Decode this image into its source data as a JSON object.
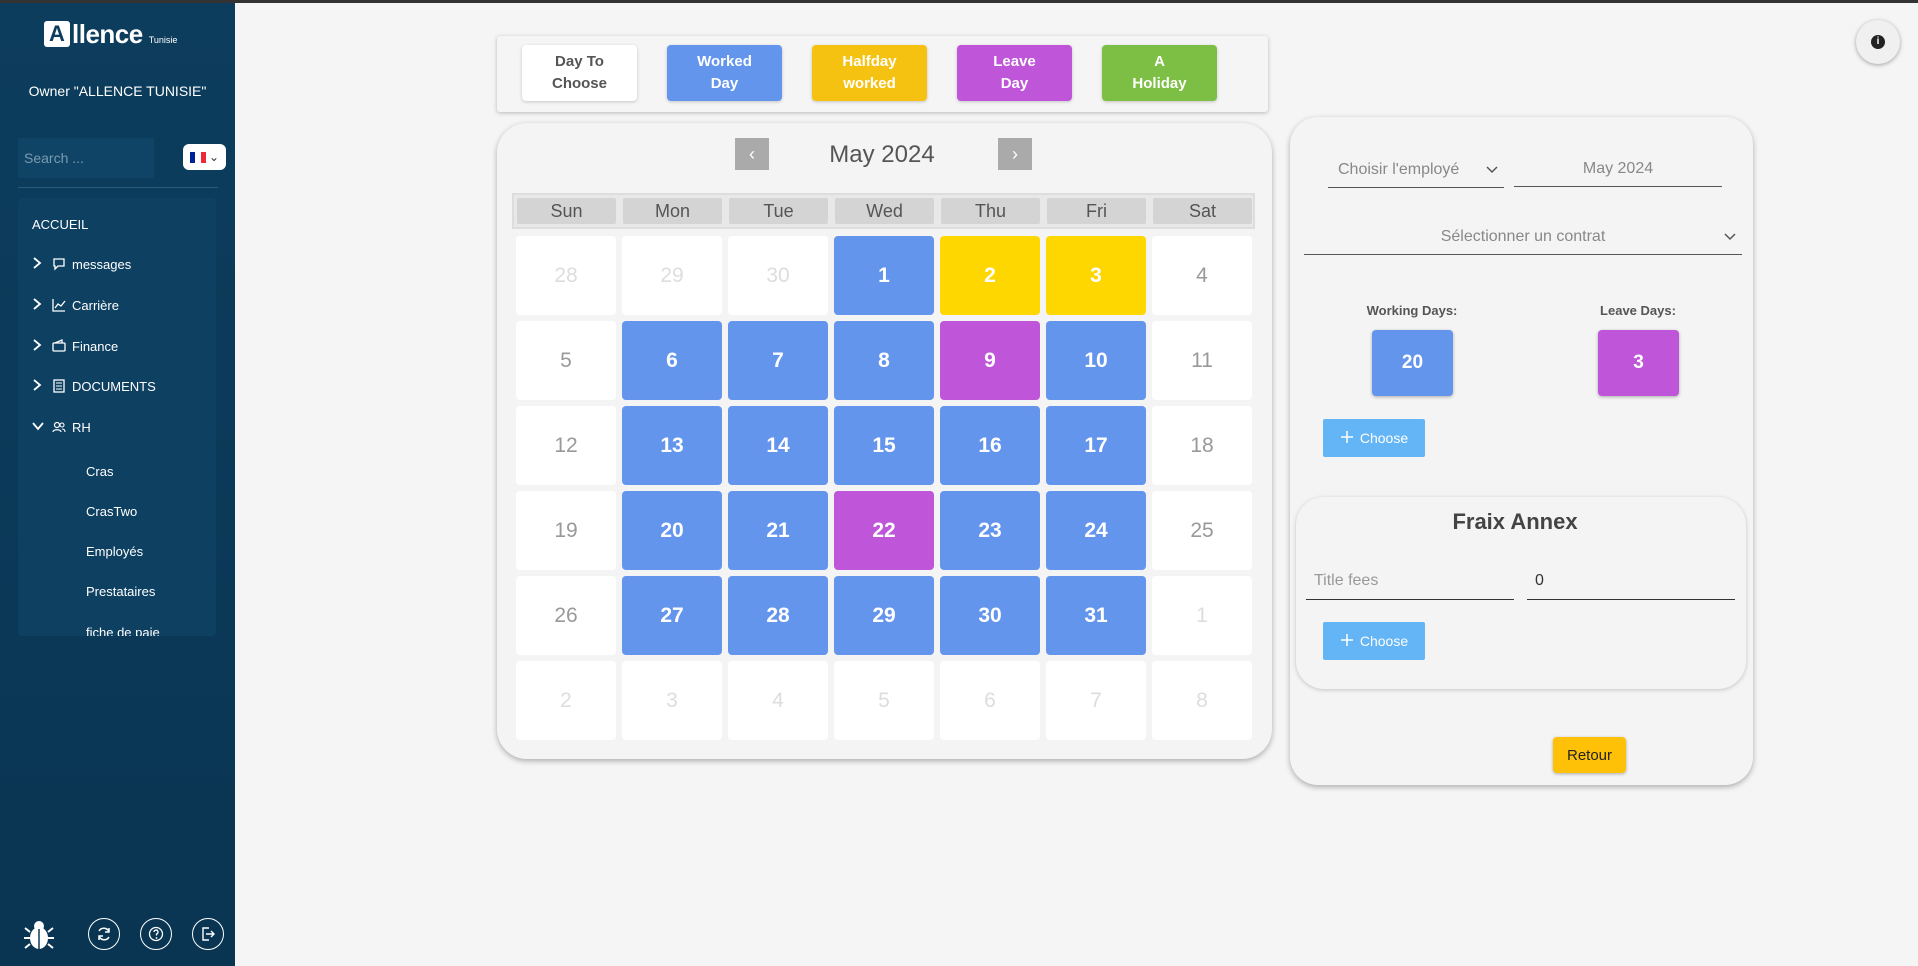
{
  "sidebar": {
    "logo_text": "llence",
    "logo_mark": "A",
    "logo_sub": "Tunisie",
    "owner": "Owner \"ALLENCE TUNISIE\"",
    "search_placeholder": "Search ...",
    "menu_heading": "ACCUEIL",
    "items": [
      {
        "label": "messages",
        "icon": "message-icon",
        "expanded": false
      },
      {
        "label": "Carrière",
        "icon": "chart-line-icon",
        "expanded": false
      },
      {
        "label": "Finance",
        "icon": "wallet-icon",
        "expanded": false
      },
      {
        "label": "DOCUMENTS",
        "icon": "document-icon",
        "expanded": false
      },
      {
        "label": "RH",
        "icon": "users-icon",
        "expanded": true
      }
    ],
    "sub_items": [
      "Cras",
      "CrasTwo",
      "Employés",
      "Prestataires",
      "fiche de paie"
    ],
    "bottom_icons": [
      "bug-icon",
      "refresh-icon",
      "help-icon",
      "logout-icon"
    ]
  },
  "legend": [
    {
      "line1": "Day To",
      "line2": "Choose",
      "color": "#ffffff",
      "text_color": "#555555"
    },
    {
      "line1": "Worked",
      "line2": "Day",
      "color": "#6495ed",
      "text_color": "#ffffff"
    },
    {
      "line1": "Halfday",
      "line2": "worked",
      "color": "#f5c211",
      "text_color": "#ffffff"
    },
    {
      "line1": "Leave",
      "line2": "Day",
      "color": "#bf55d8",
      "text_color": "#ffffff"
    },
    {
      "line1": "A",
      "line2": "Holiday",
      "color": "#7cbf44",
      "text_color": "#ffffff"
    }
  ],
  "calendar": {
    "title": "May 2024",
    "prev_label": "‹",
    "next_label": "›",
    "weekdays": [
      "Sun",
      "Mon",
      "Tue",
      "Wed",
      "Thu",
      "Fri",
      "Sat"
    ],
    "weeks": [
      [
        {
          "d": "28",
          "t": "out"
        },
        {
          "d": "29",
          "t": "out"
        },
        {
          "d": "30",
          "t": "out"
        },
        {
          "d": "1",
          "t": "worked"
        },
        {
          "d": "2",
          "t": "half"
        },
        {
          "d": "3",
          "t": "half"
        },
        {
          "d": "4",
          "t": "free"
        }
      ],
      [
        {
          "d": "5",
          "t": "free"
        },
        {
          "d": "6",
          "t": "worked"
        },
        {
          "d": "7",
          "t": "worked"
        },
        {
          "d": "8",
          "t": "worked"
        },
        {
          "d": "9",
          "t": "leave"
        },
        {
          "d": "10",
          "t": "worked"
        },
        {
          "d": "11",
          "t": "free"
        }
      ],
      [
        {
          "d": "12",
          "t": "free"
        },
        {
          "d": "13",
          "t": "worked"
        },
        {
          "d": "14",
          "t": "worked"
        },
        {
          "d": "15",
          "t": "worked"
        },
        {
          "d": "16",
          "t": "worked"
        },
        {
          "d": "17",
          "t": "worked"
        },
        {
          "d": "18",
          "t": "free"
        }
      ],
      [
        {
          "d": "19",
          "t": "free"
        },
        {
          "d": "20",
          "t": "worked"
        },
        {
          "d": "21",
          "t": "worked"
        },
        {
          "d": "22",
          "t": "leave"
        },
        {
          "d": "23",
          "t": "worked"
        },
        {
          "d": "24",
          "t": "worked"
        },
        {
          "d": "25",
          "t": "free"
        }
      ],
      [
        {
          "d": "26",
          "t": "free"
        },
        {
          "d": "27",
          "t": "worked"
        },
        {
          "d": "28",
          "t": "worked"
        },
        {
          "d": "29",
          "t": "worked"
        },
        {
          "d": "30",
          "t": "worked"
        },
        {
          "d": "31",
          "t": "worked"
        },
        {
          "d": "1",
          "t": "out"
        }
      ],
      [
        {
          "d": "2",
          "t": "out"
        },
        {
          "d": "3",
          "t": "out"
        },
        {
          "d": "4",
          "t": "out"
        },
        {
          "d": "5",
          "t": "out"
        },
        {
          "d": "6",
          "t": "out"
        },
        {
          "d": "7",
          "t": "out"
        },
        {
          "d": "8",
          "t": "out"
        }
      ]
    ]
  },
  "panel": {
    "employee_placeholder": "Choisir l'employé",
    "month_value": "May 2024",
    "contract_placeholder": "Sélectionner un contrat",
    "working_days_label": "Working Days:",
    "working_days_value": "20",
    "leave_days_label": "Leave Days:",
    "leave_days_value": "3",
    "choose_label": "Choose",
    "fees_title": "Fraix Annex",
    "fees_title_placeholder": "Title fees",
    "fees_amount_value": "0",
    "choose_label_2": "Choose",
    "retour_label": "Retour"
  },
  "colors": {
    "sidebar_bg": "#0d3d5c",
    "worked": "#6495ed",
    "halfday": "#ffd700",
    "leave": "#bf55d8",
    "holiday": "#7cbf44",
    "choose_button": "#64b5f6",
    "retour_button": "#ffc107"
  }
}
